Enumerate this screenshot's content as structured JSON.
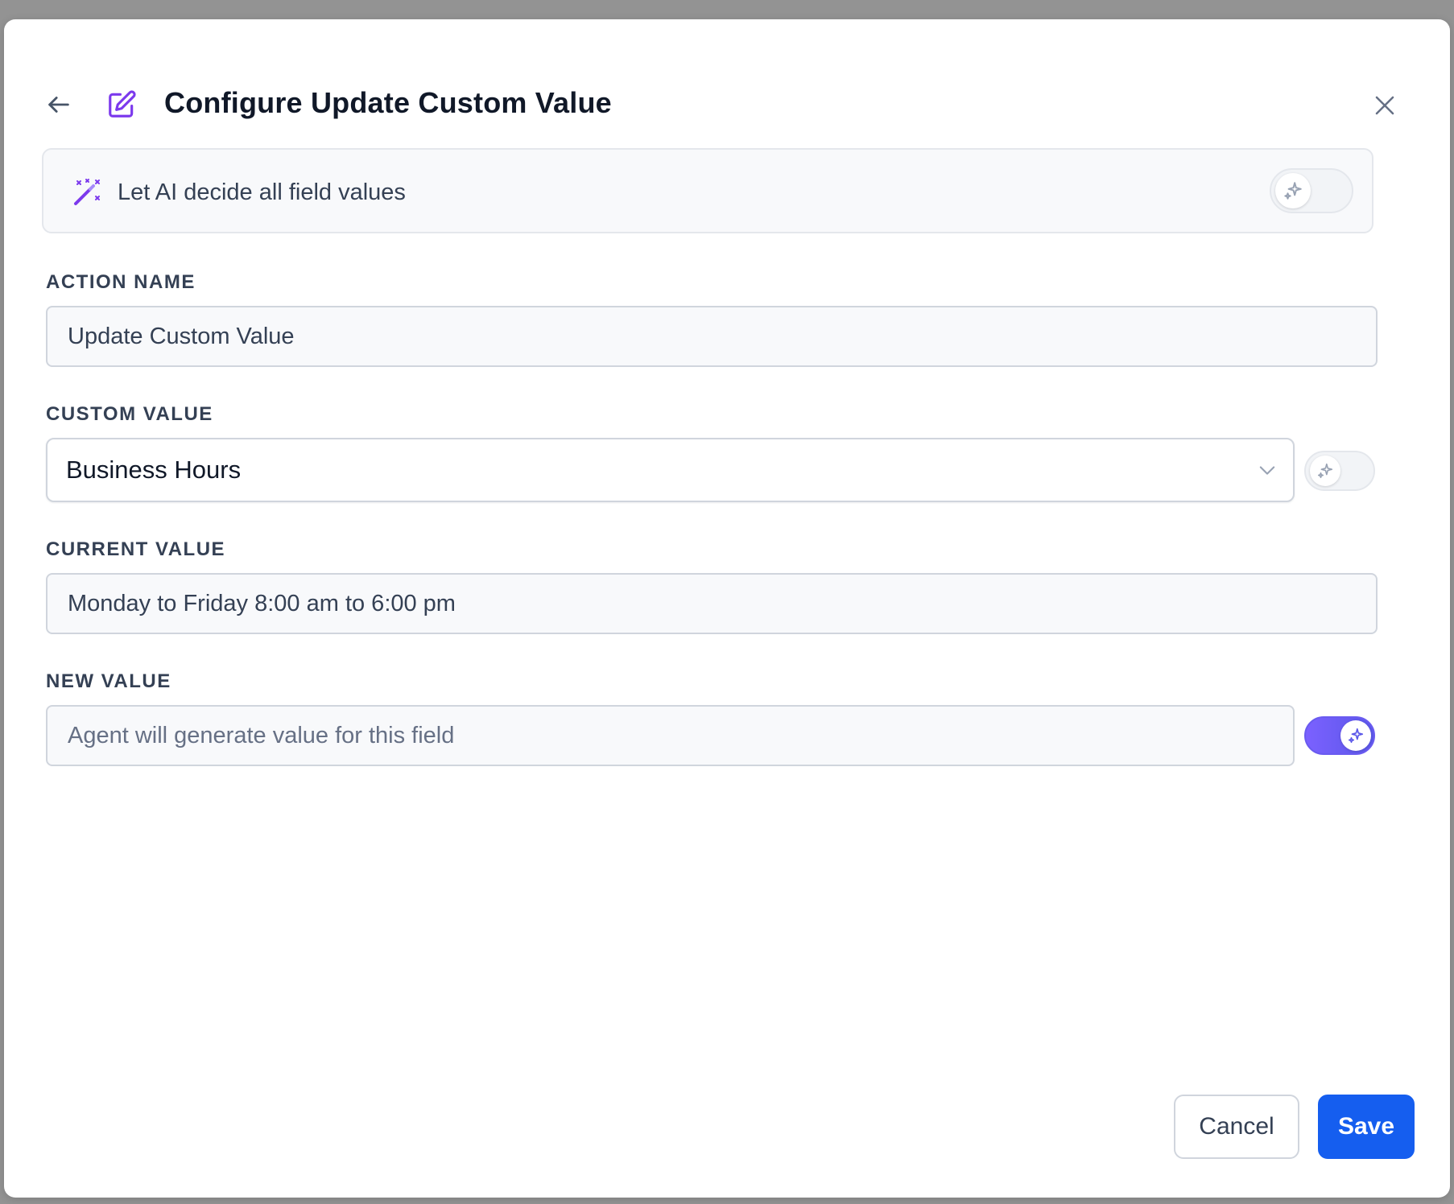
{
  "header": {
    "title": "Configure Update Custom Value"
  },
  "ai_banner": {
    "label": "Let AI decide all field values",
    "toggle_on": false
  },
  "fields": {
    "action_name": {
      "label": "ACTION NAME",
      "value": "Update Custom Value"
    },
    "custom_value": {
      "label": "CUSTOM VALUE",
      "selected": "Business Hours",
      "ai_toggle_on": false
    },
    "current_value": {
      "label": "CURRENT VALUE",
      "value": "Monday to Friday 8:00 am to 6:00 pm"
    },
    "new_value": {
      "label": "NEW VALUE",
      "placeholder": "Agent will generate value for this field",
      "ai_toggle_on": true
    }
  },
  "footer": {
    "cancel_label": "Cancel",
    "save_label": "Save"
  },
  "icons": {
    "back": "arrow-left-icon",
    "edit": "edit-icon",
    "close": "close-icon",
    "wand": "magic-wand-icon",
    "sparkle": "sparkle-icon",
    "chevron": "chevron-down-icon"
  },
  "colors": {
    "accent_purple": "#7c3aed",
    "primary_blue": "#155eef",
    "toggle_on": "#6a5bf0"
  }
}
